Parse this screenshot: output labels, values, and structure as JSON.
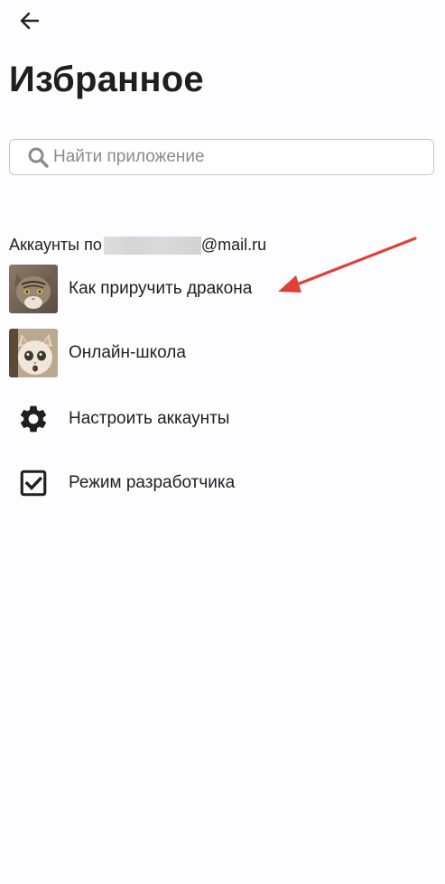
{
  "header": {
    "title": "Избранное",
    "back_icon": "arrow-left-icon"
  },
  "search": {
    "placeholder": "Найти приложение",
    "value": "",
    "icon": "search-icon"
  },
  "accounts_section": {
    "prefix": "Аккаунты по",
    "suffix": "@mail.ru",
    "items": [
      {
        "label": "Как приручить дракона",
        "icon": "cat-avatar-image"
      },
      {
        "label": "Онлайн-школа",
        "icon": "cat-avatar-image"
      },
      {
        "label": "Настроить аккаунты",
        "icon": "gear-icon"
      },
      {
        "label": "Режим разработчика",
        "icon": "checkbox-checked-icon"
      }
    ]
  },
  "colors": {
    "background": "#fdfcfe",
    "text": "#1f1f1f",
    "annotation_arrow": "#e0403a",
    "search_border": "#c9c9cc"
  }
}
